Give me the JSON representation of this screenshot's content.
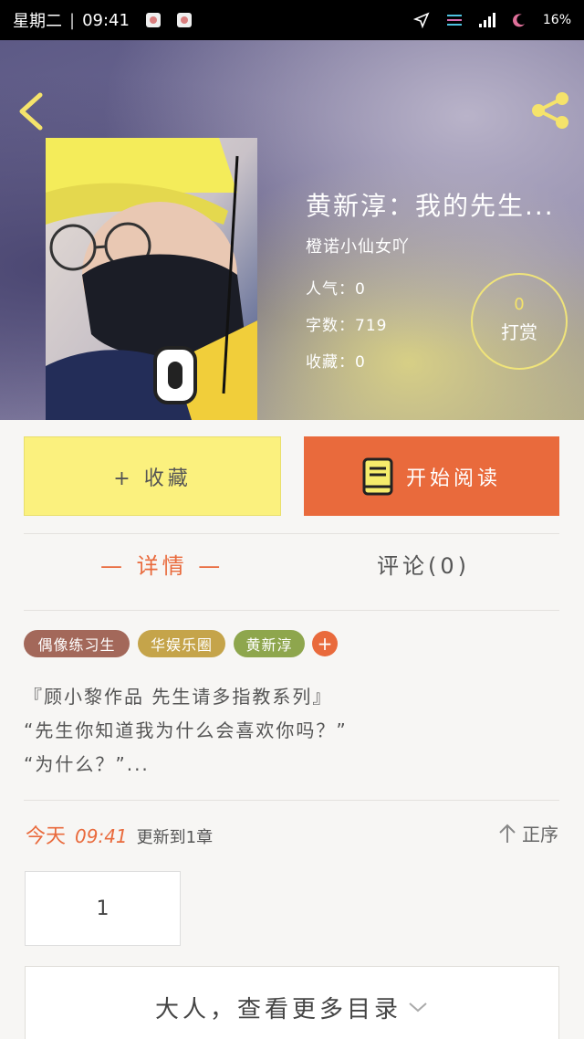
{
  "status_bar": {
    "day": "星期二",
    "time": "09:41",
    "battery": "16%"
  },
  "book": {
    "title": "黄新淳：我的先生...",
    "author": "橙诺小仙女吖",
    "popularity": "人气：0",
    "word_count": "字数：719",
    "favorites": "收藏：0",
    "reward_count": "0",
    "reward_label": "打赏"
  },
  "actions": {
    "collect_label": "+ 收藏",
    "read_label": "开始阅读"
  },
  "tabs": {
    "detail": "— 详情 —",
    "comments": "评论(0)"
  },
  "tags": [
    "偶像练习生",
    "华娱乐圈",
    "黄新淳"
  ],
  "synopsis": [
    "『顾小黎作品 先生请多指教系列』",
    "“先生你知道我为什么会喜欢你吗？”",
    "“为什么？”..."
  ],
  "update": {
    "today": "今天",
    "time": "09:41",
    "text": "更新到1章",
    "order": "正序"
  },
  "chapters": [
    "1"
  ],
  "more_catalog": "大人，查看更多目录",
  "colors": {
    "accent": "#e96a3c",
    "collect_bg": "#fbf17e",
    "tag1": "#a3685a",
    "tag2": "#c5a44a",
    "tag3": "#8ea64d"
  }
}
